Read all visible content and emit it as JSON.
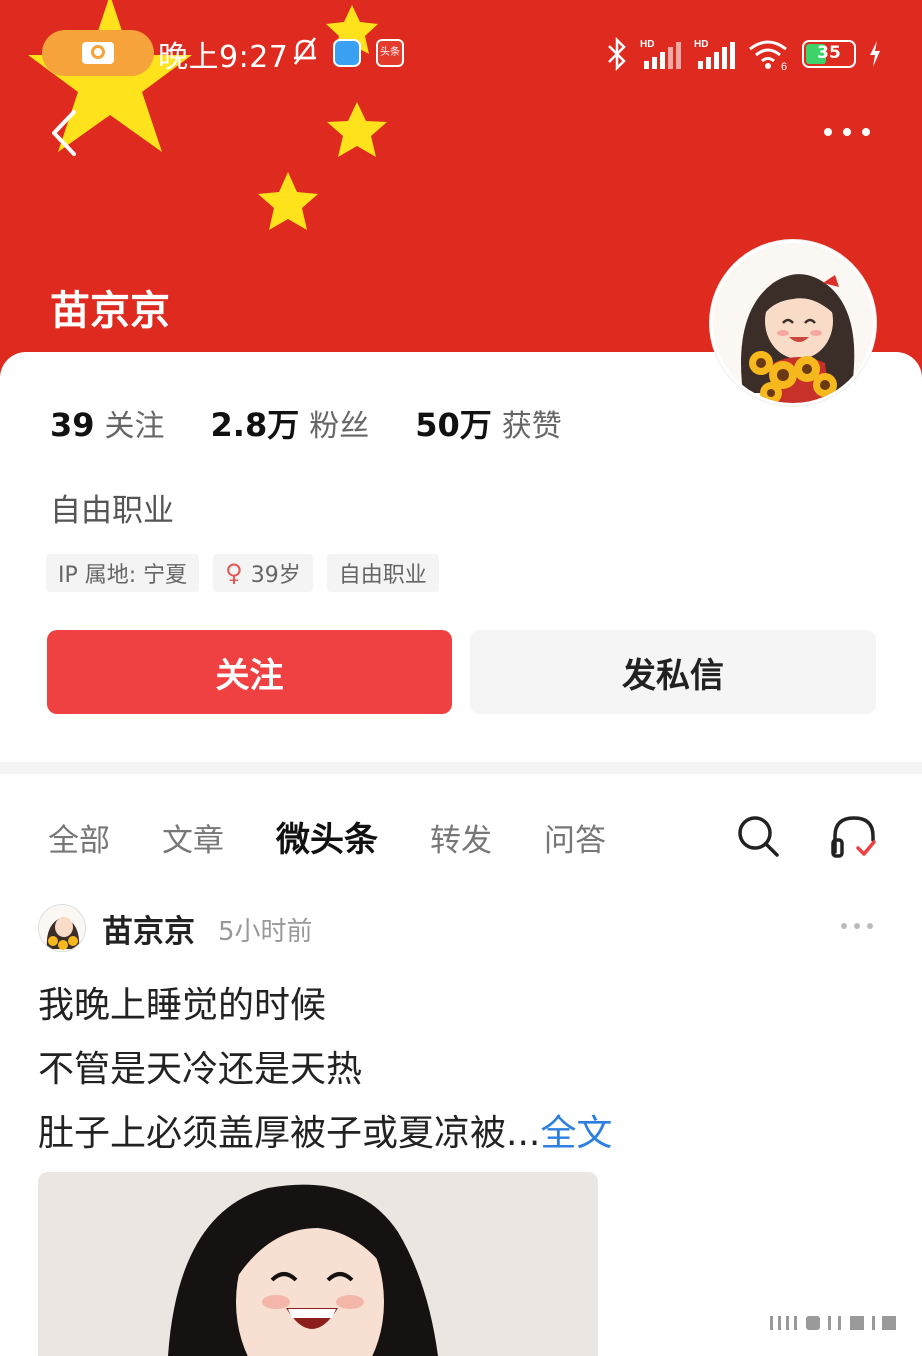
{
  "status_bar": {
    "time": "晚上9:27",
    "battery": "35",
    "app_badge": "头条"
  },
  "profile": {
    "name": "苗京京",
    "stats": [
      {
        "num": "39",
        "label": "关注"
      },
      {
        "num": "2.8万",
        "label": "粉丝"
      },
      {
        "num": "50万",
        "label": "获赞"
      }
    ],
    "bio": "自由职业",
    "tags": {
      "ip": "IP 属地: 宁夏",
      "age": "39岁",
      "job": "自由职业"
    }
  },
  "actions": {
    "follow": "关注",
    "message": "发私信"
  },
  "tabs": [
    "全部",
    "文章",
    "微头条",
    "转发",
    "问答"
  ],
  "post": {
    "author": "苗京京",
    "time": "5小时前",
    "lines": [
      "我晚上睡觉的时候",
      "不管是天冷还是天热",
      "肚子上必须盖厚被子或夏凉被..."
    ],
    "full_link": "全文"
  },
  "colors": {
    "banner_red": "#de2a1f",
    "star_yellow": "#fde21c",
    "follow_red": "#f04142",
    "link_blue": "#2d7fe0"
  },
  "icons": [
    "camera-icon",
    "mute-bell-icon",
    "bluetooth-icon",
    "signal-icon",
    "wifi-icon",
    "battery-icon",
    "back-icon",
    "more-icon",
    "search-icon",
    "headphone-icon",
    "female-icon"
  ]
}
